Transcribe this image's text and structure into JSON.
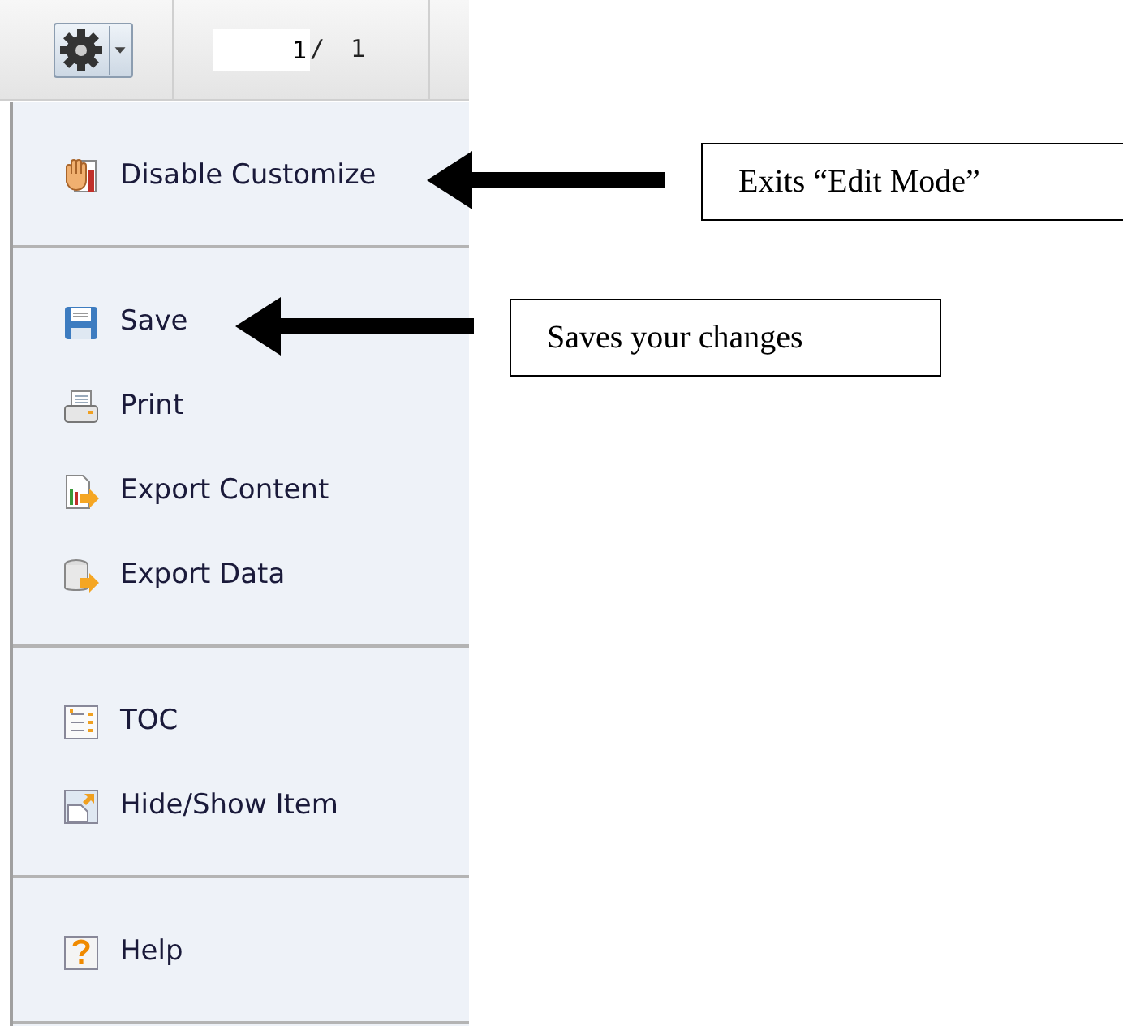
{
  "toolbar": {
    "page_value": "1",
    "page_separator": "/",
    "page_total": "1"
  },
  "menu": {
    "sections": [
      [
        {
          "label": "Disable Customize",
          "kind": "hand"
        }
      ],
      [
        {
          "label": "Save",
          "kind": "disk"
        },
        {
          "label": "Print",
          "kind": "printer"
        },
        {
          "label": "Export Content",
          "kind": "export-content"
        },
        {
          "label": "Export Data",
          "kind": "export-data"
        }
      ],
      [
        {
          "label": "TOC",
          "kind": "toc"
        },
        {
          "label": "Hide/Show Item",
          "kind": "hide-show"
        }
      ],
      [
        {
          "label": "Help",
          "kind": "help"
        }
      ]
    ]
  },
  "annotations": [
    {
      "text": "Exits “Edit Mode”"
    },
    {
      "text": "Saves your changes"
    }
  ]
}
